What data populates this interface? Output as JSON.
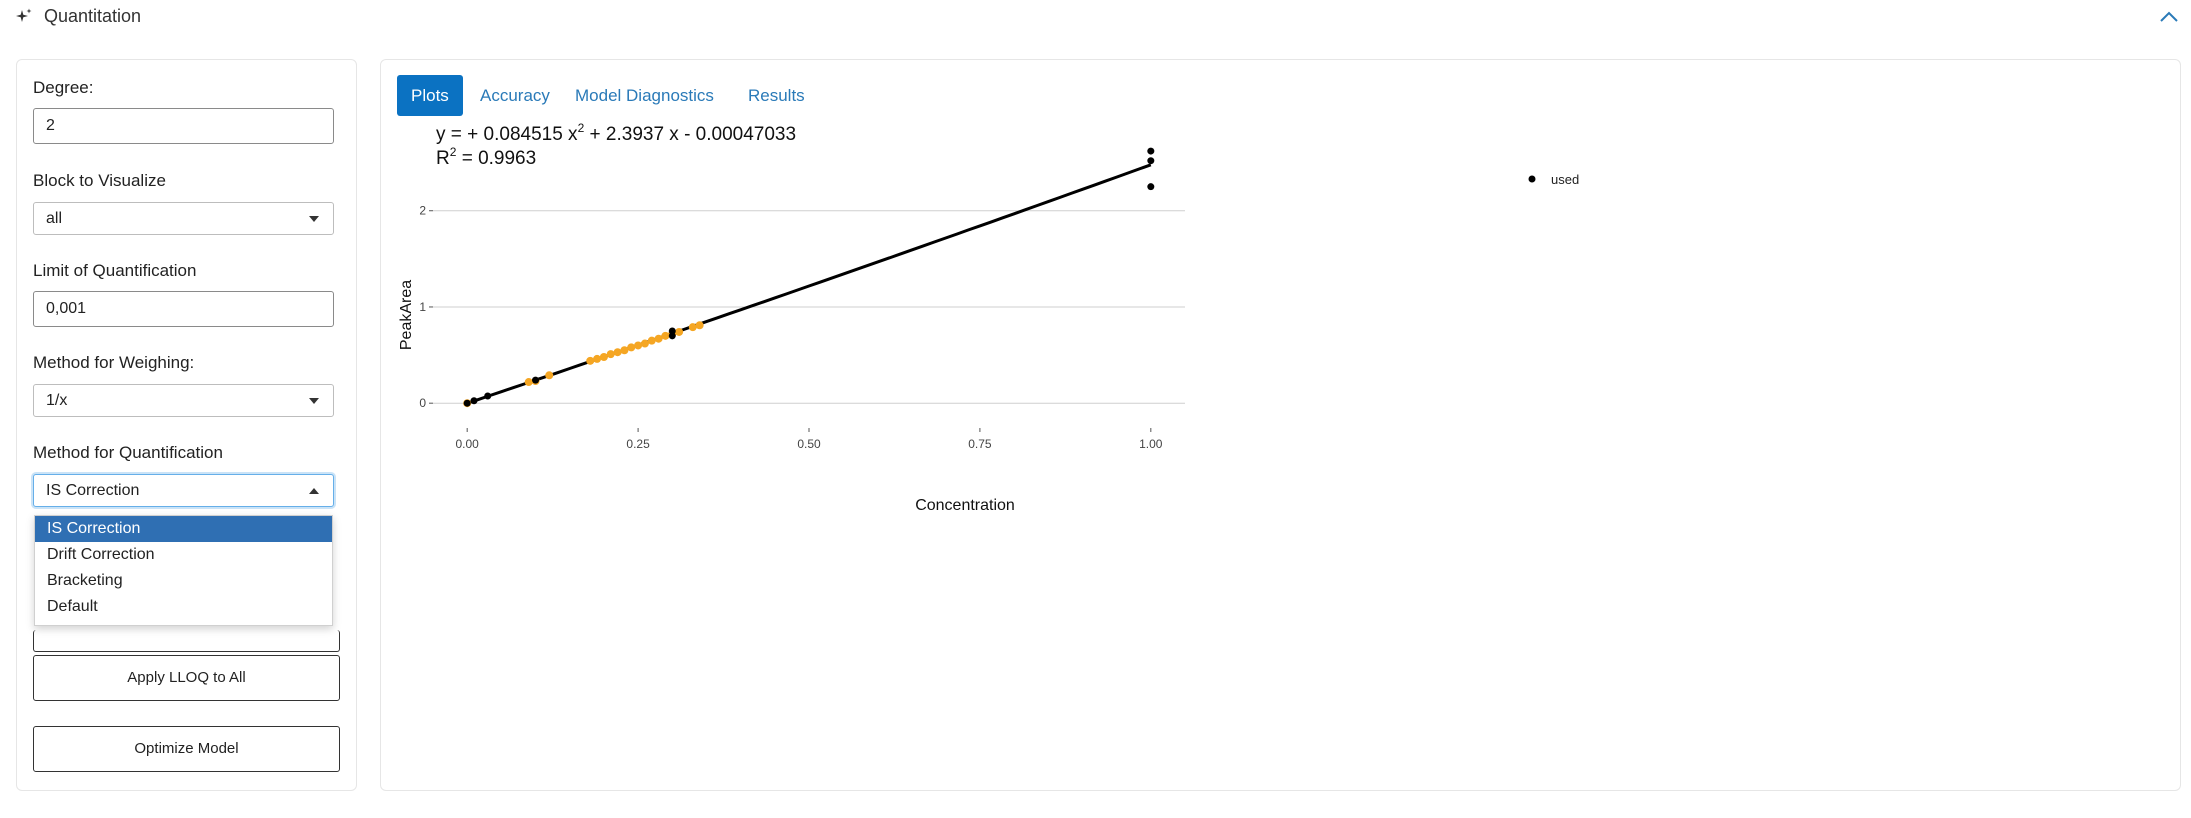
{
  "panel": {
    "title": "Quantitation",
    "icon": "sparkles-icon",
    "collapse_icon": "chevron-up-icon"
  },
  "sidebar": {
    "degree": {
      "label": "Degree:",
      "value": "2"
    },
    "block": {
      "label": "Block to Visualize",
      "value": "all"
    },
    "loq": {
      "label": "Limit of Quantification",
      "value": "0,001"
    },
    "weighing": {
      "label": "Method for Weighing:",
      "value": "1/x"
    },
    "quant": {
      "label": "Method for Quantification",
      "value": "IS Correction",
      "options": [
        "IS Correction",
        "Drift Correction",
        "Bracketing",
        "Default"
      ]
    },
    "buttons": {
      "apply_llq": "Apply LLOQ to All",
      "optimize": "Optimize Model"
    }
  },
  "tabs": [
    "Plots",
    "Accuracy",
    "Model Diagnostics",
    "Results"
  ],
  "plot": {
    "equation": {
      "prefix": "y =  + 0.084515 x",
      "rest": " + 2.3937 x - 0.00047033"
    },
    "r2": {
      "label": "R",
      "value": " = 0.9963"
    },
    "colors": {
      "used": "#000000",
      "other": "#f5a623"
    }
  },
  "chart_data": {
    "type": "scatter",
    "xlabel": "Concentration",
    "ylabel": "PeakArea",
    "xlim": [
      -0.05,
      1.05
    ],
    "ylim": [
      -0.05,
      2.6
    ],
    "xticks": [
      "0.00",
      "0.25",
      "0.50",
      "0.75",
      "1.00"
    ],
    "yticks": [
      "0",
      "1",
      "2"
    ],
    "legend": [
      "used"
    ],
    "fit": {
      "a": 0.084515,
      "b": 2.3937,
      "c": -0.00047033
    },
    "series": [
      {
        "name": "used",
        "x": [
          0.0,
          0.01,
          0.03,
          0.1,
          0.3,
          0.3,
          1.0,
          1.0,
          1.0
        ],
        "y": [
          0.0,
          0.025,
          0.075,
          0.24,
          0.75,
          0.7,
          2.62,
          2.52,
          2.25
        ]
      },
      {
        "name": "",
        "x": [
          0.0,
          0.09,
          0.1,
          0.12,
          0.18,
          0.19,
          0.2,
          0.21,
          0.22,
          0.23,
          0.24,
          0.25,
          0.26,
          0.27,
          0.28,
          0.29,
          0.3,
          0.31,
          0.33,
          0.34
        ],
        "y": [
          0.0,
          0.22,
          0.23,
          0.29,
          0.44,
          0.46,
          0.48,
          0.51,
          0.53,
          0.55,
          0.58,
          0.6,
          0.62,
          0.65,
          0.67,
          0.7,
          0.72,
          0.74,
          0.79,
          0.81
        ]
      }
    ]
  }
}
